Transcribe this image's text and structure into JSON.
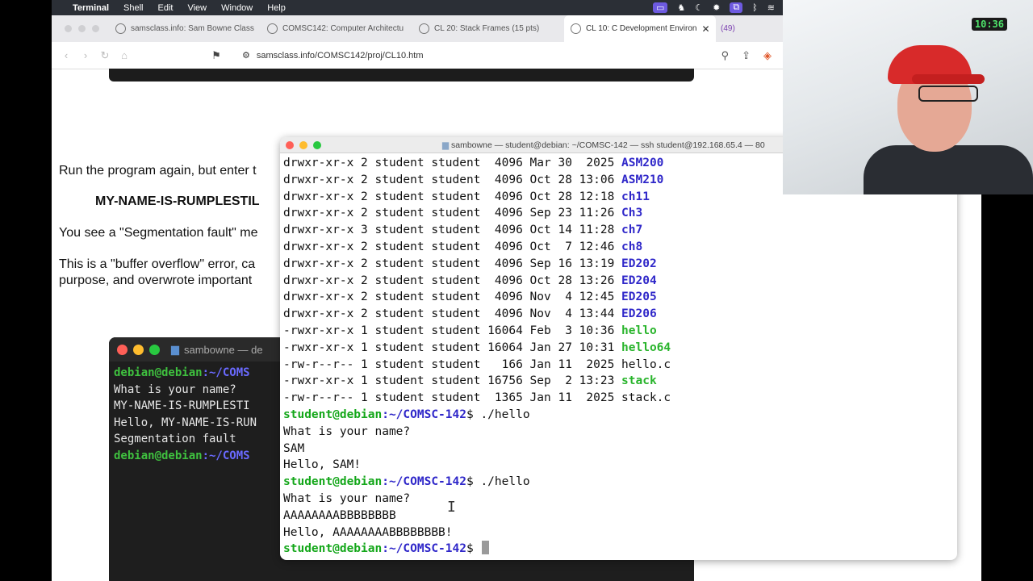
{
  "menubar": {
    "app": "Terminal",
    "items": [
      "Shell",
      "Edit",
      "View",
      "Window",
      "Help"
    ]
  },
  "browser": {
    "tabs": [
      {
        "label": "samsclass.info: Sam Bowne Class"
      },
      {
        "label": "COMSC142: Computer Architectu"
      },
      {
        "label": "CL 20: Stack Frames (15 pts)"
      },
      {
        "label": "CL 10: C Development Environ"
      }
    ],
    "tab_count": "(49)",
    "url": "samsclass.info/COMSC142/proj/CL10.htm"
  },
  "document": {
    "p1": "Run the program again, but enter t",
    "p2": "MY-NAME-IS-RUMPLESTIL",
    "p3": "You see a \"Segmentation fault\" me",
    "p4a": "This is a \"buffer overflow\" error, ca",
    "p4b": "purpose, and overwrote important"
  },
  "back_terminal": {
    "title": "sambowne — de",
    "lines": [
      {
        "prompt": "debian@debian:~/COMS",
        "text": ""
      },
      {
        "prompt": "",
        "text": "What is your name?"
      },
      {
        "prompt": "",
        "text": "MY-NAME-IS-RUMPLESTI"
      },
      {
        "prompt": "",
        "text": "Hello, MY-NAME-IS-RUN"
      },
      {
        "prompt": "",
        "text": "Segmentation fault"
      },
      {
        "prompt": "debian@debian:~/COMS",
        "text": ""
      }
    ]
  },
  "front_terminal": {
    "title": "sambowne — student@debian: ~/COMSC-142 — ssh student@192.168.65.4 — 80",
    "listing": [
      {
        "perms": "drwxr-xr-x",
        "links": "2",
        "user": "student",
        "group": "student",
        "size": "4096",
        "date": "Mar 30  2025",
        "name": "ASM200",
        "kind": "dir"
      },
      {
        "perms": "drwxr-xr-x",
        "links": "2",
        "user": "student",
        "group": "student",
        "size": "4096",
        "date": "Oct 28 13:06",
        "name": "ASM210",
        "kind": "dir"
      },
      {
        "perms": "drwxr-xr-x",
        "links": "2",
        "user": "student",
        "group": "student",
        "size": "4096",
        "date": "Oct 28 12:18",
        "name": "ch11",
        "kind": "dir"
      },
      {
        "perms": "drwxr-xr-x",
        "links": "2",
        "user": "student",
        "group": "student",
        "size": "4096",
        "date": "Sep 23 11:26",
        "name": "Ch3",
        "kind": "dir"
      },
      {
        "perms": "drwxr-xr-x",
        "links": "3",
        "user": "student",
        "group": "student",
        "size": "4096",
        "date": "Oct 14 11:28",
        "name": "ch7",
        "kind": "dir"
      },
      {
        "perms": "drwxr-xr-x",
        "links": "2",
        "user": "student",
        "group": "student",
        "size": "4096",
        "date": "Oct  7 12:46",
        "name": "ch8",
        "kind": "dir"
      },
      {
        "perms": "drwxr-xr-x",
        "links": "2",
        "user": "student",
        "group": "student",
        "size": "4096",
        "date": "Sep 16 13:19",
        "name": "ED202",
        "kind": "dir"
      },
      {
        "perms": "drwxr-xr-x",
        "links": "2",
        "user": "student",
        "group": "student",
        "size": "4096",
        "date": "Oct 28 13:26",
        "name": "ED204",
        "kind": "dir"
      },
      {
        "perms": "drwxr-xr-x",
        "links": "2",
        "user": "student",
        "group": "student",
        "size": "4096",
        "date": "Nov  4 12:45",
        "name": "ED205",
        "kind": "dir"
      },
      {
        "perms": "drwxr-xr-x",
        "links": "2",
        "user": "student",
        "group": "student",
        "size": "4096",
        "date": "Nov  4 13:44",
        "name": "ED206",
        "kind": "dir"
      },
      {
        "perms": "-rwxr-xr-x",
        "links": "1",
        "user": "student",
        "group": "student",
        "size": "16064",
        "date": "Feb  3 10:36",
        "name": "hello",
        "kind": "exe"
      },
      {
        "perms": "-rwxr-xr-x",
        "links": "1",
        "user": "student",
        "group": "student",
        "size": "16064",
        "date": "Jan 27 10:31",
        "name": "hello64",
        "kind": "exe"
      },
      {
        "perms": "-rw-r--r--",
        "links": "1",
        "user": "student",
        "group": "student",
        "size": "166",
        "date": "Jan 11  2025",
        "name": "hello.c",
        "kind": "file"
      },
      {
        "perms": "-rwxr-xr-x",
        "links": "1",
        "user": "student",
        "group": "student",
        "size": "16756",
        "date": "Sep  2 13:23",
        "name": "stack",
        "kind": "exe"
      },
      {
        "perms": "-rw-r--r--",
        "links": "1",
        "user": "student",
        "group": "student",
        "size": "1365",
        "date": "Jan 11  2025",
        "name": "stack.c",
        "kind": "file"
      }
    ],
    "prompt_user": "student@debian",
    "prompt_path": ":~/COMSC-142",
    "prompt_sym": "$ ",
    "session": [
      {
        "type": "prompt",
        "cmd": "./hello"
      },
      {
        "type": "out",
        "text": "What is your name?"
      },
      {
        "type": "out",
        "text": "SAM"
      },
      {
        "type": "out",
        "text": "Hello, SAM!"
      },
      {
        "type": "prompt",
        "cmd": "./hello"
      },
      {
        "type": "out",
        "text": "What is your name?"
      },
      {
        "type": "out",
        "text": "AAAAAAAABBBBBBBB"
      },
      {
        "type": "out",
        "text": "Hello, AAAAAAAABBBBBBBB!"
      },
      {
        "type": "prompt",
        "cmd": "",
        "cursor": true
      }
    ]
  },
  "webcam": {
    "clock": "10:36"
  },
  "colors": {
    "dir": "#2f27c9",
    "exe": "#28b42b",
    "prompt_green": "#14a71a"
  }
}
